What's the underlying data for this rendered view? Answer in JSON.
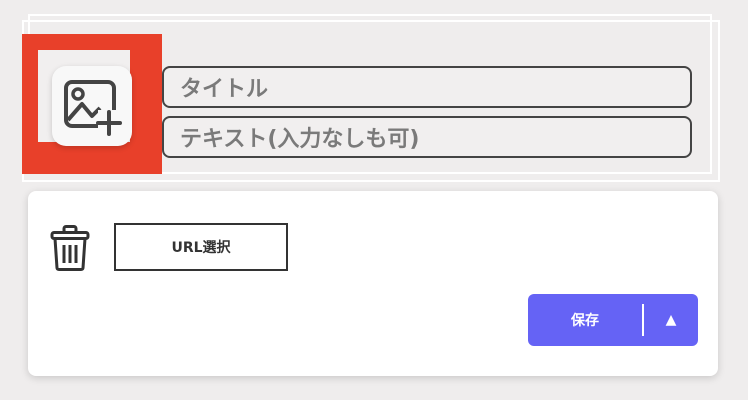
{
  "fields": {
    "title_placeholder": "タイトル",
    "text_placeholder": "テキスト(入力なしも可)"
  },
  "actions": {
    "url_select_label": "URL選択",
    "save_label": "保存",
    "dropdown_arrow": "▲"
  },
  "icons": {
    "image_add": "add-image-icon",
    "delete": "trash-icon"
  },
  "colors": {
    "background": "#efeded",
    "highlight_frame": "#e8402a",
    "save_button": "#6563f5"
  }
}
